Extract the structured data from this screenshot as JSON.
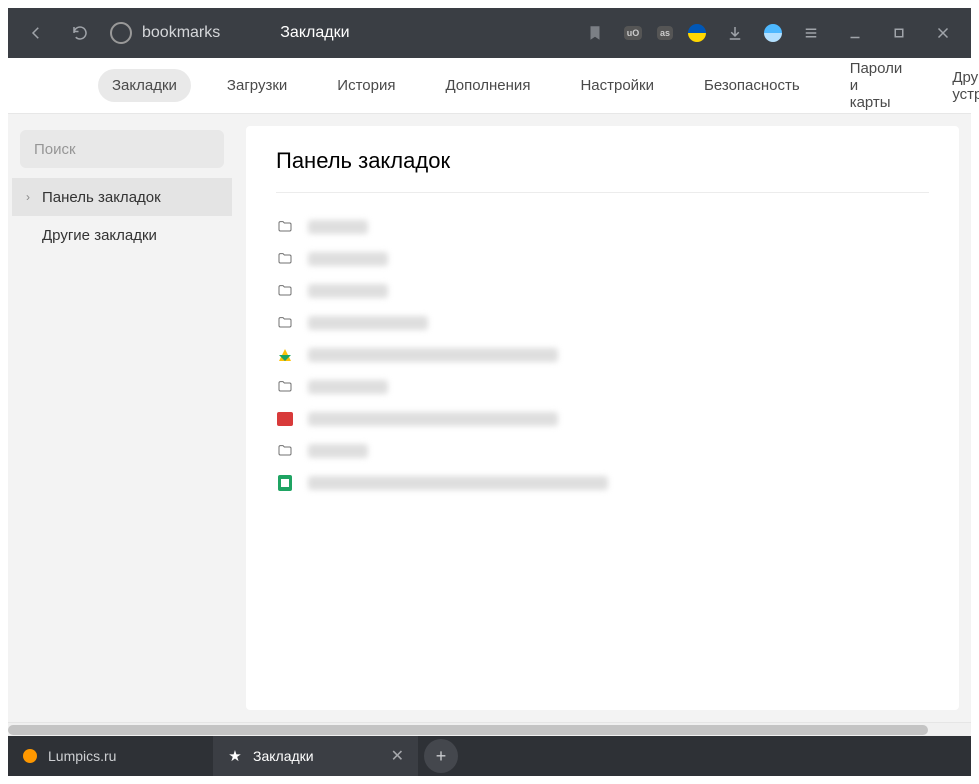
{
  "titlebar": {
    "url_text": "bookmarks",
    "page_title": "Закладки"
  },
  "nav": {
    "items": [
      {
        "label": "Закладки",
        "active": true
      },
      {
        "label": "Загрузки",
        "active": false
      },
      {
        "label": "История",
        "active": false
      },
      {
        "label": "Дополнения",
        "active": false
      },
      {
        "label": "Настройки",
        "active": false
      },
      {
        "label": "Безопасность",
        "active": false
      },
      {
        "label": "Пароли и карты",
        "active": false
      },
      {
        "label": "Другие устройства",
        "active": false
      }
    ]
  },
  "sidebar": {
    "search_placeholder": "Поиск",
    "items": [
      {
        "label": "Панель закладок",
        "active": true,
        "expandable": true
      },
      {
        "label": "Другие закладки",
        "active": false,
        "expandable": false
      }
    ]
  },
  "main": {
    "title": "Панель закладок",
    "bookmarks": [
      {
        "icon": "folder",
        "blur_w": "w60"
      },
      {
        "icon": "folder",
        "blur_w": "w80"
      },
      {
        "icon": "folder",
        "blur_w": "w80"
      },
      {
        "icon": "folder",
        "blur_w": "w120"
      },
      {
        "icon": "drive",
        "blur_w": "w250"
      },
      {
        "icon": "folder",
        "blur_w": "w80"
      },
      {
        "icon": "red",
        "blur_w": "w250"
      },
      {
        "icon": "folder",
        "blur_w": "w60"
      },
      {
        "icon": "sheets",
        "blur_w": "w300"
      }
    ]
  },
  "tabs": [
    {
      "label": "Lumpics.ru",
      "icon": "orange",
      "active": false
    },
    {
      "label": "Закладки",
      "icon": "star",
      "active": true
    }
  ],
  "extensions": {
    "ublock": "uO",
    "lastfm": "as"
  }
}
